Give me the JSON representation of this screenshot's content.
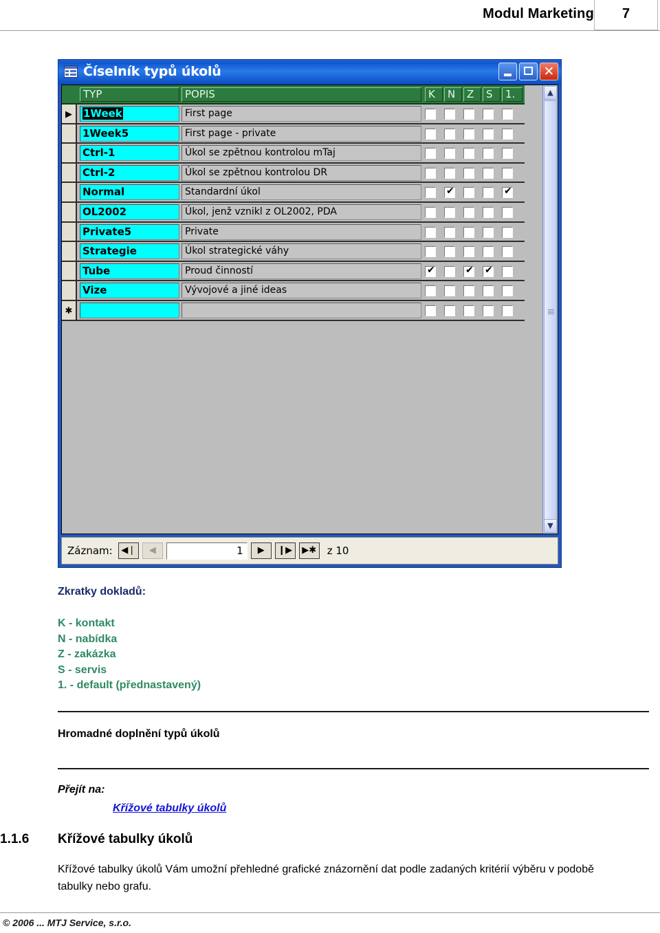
{
  "header": {
    "title": "Modul Marketing",
    "page_number": "7"
  },
  "window": {
    "title": "Číselník typů úkolů",
    "icon": "datasheet-icon",
    "buttons": {
      "minimize": "_",
      "maximize": "□",
      "close": "✕"
    },
    "columns": {
      "typ": "TYP",
      "popis": "POPIS",
      "k": "K",
      "n": "N",
      "z": "Z",
      "s": "S",
      "one": "1."
    },
    "rows": [
      {
        "marker": "▶",
        "typ": "1Week",
        "popis": "First page",
        "checks": [
          false,
          false,
          false,
          false,
          false
        ],
        "selected": true
      },
      {
        "marker": "",
        "typ": "1Week5",
        "popis": "First page - private",
        "checks": [
          false,
          false,
          false,
          false,
          false
        ],
        "selected": false
      },
      {
        "marker": "",
        "typ": "Ctrl-1",
        "popis": "Úkol se zpětnou kontrolou mTaj",
        "checks": [
          false,
          false,
          false,
          false,
          false
        ],
        "selected": false
      },
      {
        "marker": "",
        "typ": "Ctrl-2",
        "popis": "Úkol se zpětnou kontrolou DR",
        "checks": [
          false,
          false,
          false,
          false,
          false
        ],
        "selected": false
      },
      {
        "marker": "",
        "typ": "Normal",
        "popis": "Standardní úkol",
        "checks": [
          false,
          true,
          false,
          false,
          true
        ],
        "selected": false
      },
      {
        "marker": "",
        "typ": "OL2002",
        "popis": "Úkol, jenž vznikl z OL2002, PDA",
        "checks": [
          false,
          false,
          false,
          false,
          false
        ],
        "selected": false
      },
      {
        "marker": "",
        "typ": "Private5",
        "popis": "Private",
        "checks": [
          false,
          false,
          false,
          false,
          false
        ],
        "selected": false
      },
      {
        "marker": "",
        "typ": "Strategie",
        "popis": "Úkol strategické váhy",
        "checks": [
          false,
          false,
          false,
          false,
          false
        ],
        "selected": false
      },
      {
        "marker": "",
        "typ": "Tube",
        "popis": "Proud činností",
        "checks": [
          true,
          false,
          true,
          true,
          false
        ],
        "selected": false
      },
      {
        "marker": "",
        "typ": "Vize",
        "popis": "Vývojové a jiné ideas",
        "checks": [
          false,
          false,
          false,
          false,
          false
        ],
        "selected": false
      },
      {
        "marker": "✱",
        "typ": "",
        "popis": "",
        "checks": [
          false,
          false,
          false,
          false,
          false
        ],
        "selected": false
      }
    ],
    "navigation": {
      "label": "Záznam:",
      "first": "◀❘",
      "prev": "◀",
      "current": "1",
      "next": "▶",
      "last": "❙▶",
      "new": "▶✱",
      "total": "z 10"
    },
    "scrollbar": {
      "up": "▲",
      "down": "▼"
    }
  },
  "document": {
    "legend_title": "Zkratky dokladů:",
    "legend_items": [
      "K - kontakt",
      "N - nabídka",
      "Z - zakázka",
      "S - servis",
      "1. - default (přednastavený)"
    ],
    "block_title": "Hromadné doplnění typů úkolů",
    "goto_label": "Přejít na:",
    "goto_link": "Křížové tabulky úkolů",
    "section_number": "1.1.6",
    "section_title": "Křížové tabulky úkolů",
    "section_body": "Křížové tabulky úkolů Vám umožní přehledné grafické znázornění dat podle zadaných kritérií výběru v podobě tabulky nebo grafu."
  },
  "footer": {
    "copyright": "© 2006 ... MTJ Service, s.r.o."
  },
  "colors": {
    "titlebar_blue": "#1f62d4",
    "grid_header_green": "#2d7a3e",
    "typ_cell_cyan": "#00ffff",
    "legend_heading": "#1b2a6b",
    "legend_items": "#2f8a63",
    "link_blue": "#1414d8"
  }
}
